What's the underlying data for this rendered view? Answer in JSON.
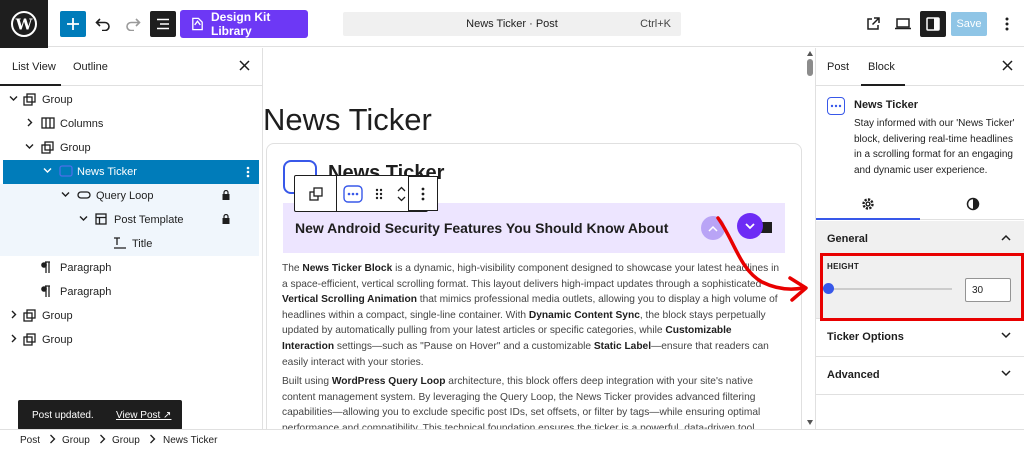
{
  "topbar": {
    "design_kit_label": "Design Kit Library",
    "command_title": "News Ticker · Post",
    "command_shortcut": "Ctrl+K",
    "save_label": "Save"
  },
  "left_panel": {
    "tabs": [
      "List View",
      "Outline"
    ],
    "tree": [
      {
        "label": "Group"
      },
      {
        "label": "Columns"
      },
      {
        "label": "Group"
      },
      {
        "label": "News Ticker"
      },
      {
        "label": "Query Loop"
      },
      {
        "label": "Post Template"
      },
      {
        "label": "Title"
      },
      {
        "label": "Paragraph"
      },
      {
        "label": "Paragraph"
      },
      {
        "label": "Group"
      },
      {
        "label": "Group"
      }
    ]
  },
  "snackbar": {
    "message": "Post updated.",
    "link": "View Post ↗"
  },
  "canvas": {
    "page_title": "News Ticker",
    "card_title": "News Ticker",
    "ticker_headline": "New Android Security Features You Should Know About"
  },
  "right_panel": {
    "tabs": [
      "Post",
      "Block"
    ],
    "block_name": "News Ticker",
    "block_description": "Stay informed with our 'News Ticker' block, delivering real-time headlines in a scrolling format for an engaging and dynamic user experience.",
    "general_title": "General",
    "height_label": "HEIGHT",
    "height_value": "30",
    "height_fraction": 0.0,
    "sections": [
      "Ticker Options",
      "Advanced"
    ]
  },
  "breadcrumb": [
    "Post",
    "Group",
    "Group",
    "News Ticker"
  ],
  "colors": {
    "wp_admin_blue": "#007cba",
    "accent_blue": "#3858e9",
    "design_kit_purple": "#6d38f5",
    "ticker_bg": "#ede5ff",
    "annotation_red": "#e80000"
  }
}
